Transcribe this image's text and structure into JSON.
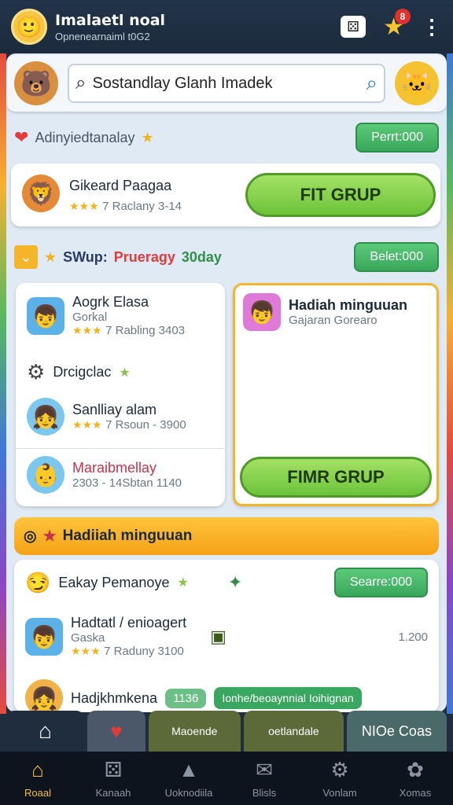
{
  "header": {
    "title": "Imalaetl noal",
    "subtitle": "Opnenearnaiml t0G2",
    "notification_count": "8"
  },
  "search": {
    "value": "Sostandlay Glanh Imadek"
  },
  "section1": {
    "title": "Adinyiedtanalay",
    "button": "Perrt:000"
  },
  "featured": {
    "name": "Gikeard Paagaa",
    "meta": "7 Raclany 3-14",
    "button": "FIT GRUP"
  },
  "section2": {
    "title_a": "SWup:",
    "title_b": "Prueragy",
    "title_c": "30day",
    "button": "Belet:000"
  },
  "list_left": [
    {
      "name": "Aogrk Elasa",
      "sub": "Gorkal",
      "meta": "7 Rabling 3403"
    },
    {
      "name": "Drcigclac",
      "sub": "",
      "meta": ""
    },
    {
      "name": "Sanlliay alam",
      "sub": "",
      "meta": "7 Rsoun - 3900"
    },
    {
      "name": "Maraibmellay",
      "sub": "",
      "meta": "2303 - 14Sbtan 1140"
    }
  ],
  "right_card": {
    "name": "Hadiah minguuan",
    "sub": "Gajaran Gorearo",
    "button": "FIMR GRUP"
  },
  "banner": {
    "title": "Hadiiah minguuan"
  },
  "section3": {
    "title": "Eakay Pemanoye",
    "button": "Searre:000"
  },
  "list_bottom": [
    {
      "name": "Hadtatl / enioagert",
      "sub": "Gaska",
      "meta": "7 Raduny 3100",
      "value": "1.200"
    },
    {
      "name": "Hadjkhmkena",
      "chip": "1136",
      "link": "Ionhe/beoaynnial Ioihignan"
    }
  ],
  "bottom_tabs": [
    "Maoende",
    "oetlandale",
    "NIOe Coas"
  ],
  "nav": [
    {
      "label": "Roaal",
      "icon": "home-icon"
    },
    {
      "label": "Kanaah",
      "icon": "dice-icon"
    },
    {
      "label": "Uoknodiila",
      "icon": "tent-icon"
    },
    {
      "label": "Blisls",
      "icon": "chat-icon"
    },
    {
      "label": "Vonlam",
      "icon": "gear-icon"
    },
    {
      "label": "Xomas",
      "icon": "settings-icon"
    }
  ],
  "colors": {
    "accent_green": "#39a85b",
    "accent_orange": "#f5a216",
    "header_bg": "#1c2a3c"
  }
}
